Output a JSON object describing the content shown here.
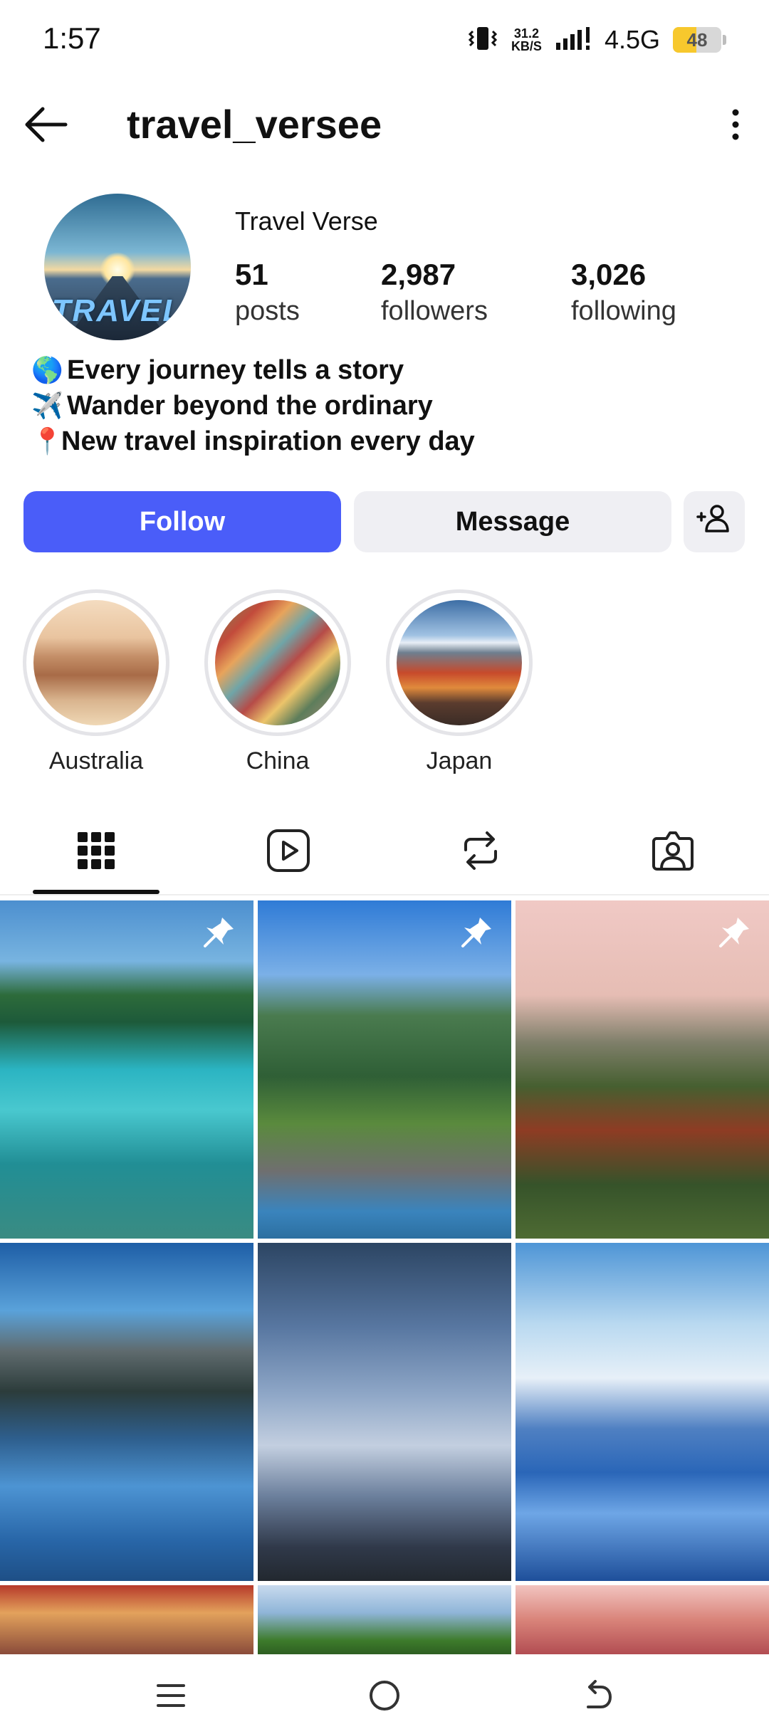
{
  "status_bar": {
    "time": "1:57",
    "net_speed_value": "31.2",
    "net_speed_unit": "KB/S",
    "network_type": "4.5G",
    "battery_level": "48"
  },
  "header": {
    "username": "travel_versee"
  },
  "profile": {
    "display_name": "Travel Verse",
    "avatar_text": "TRAVEL",
    "stats": [
      {
        "value": "51",
        "label": "posts"
      },
      {
        "value": "2,987",
        "label": "followers"
      },
      {
        "value": "3,026",
        "label": "following"
      }
    ],
    "bio": [
      {
        "emoji": "🌎",
        "text": "Every journey tells a story"
      },
      {
        "emoji": "✈️",
        "text": "Wander beyond the ordinary"
      },
      {
        "emoji": "📍",
        "text": "New travel inspiration every day"
      }
    ]
  },
  "actions": {
    "follow_label": "Follow",
    "message_label": "Message"
  },
  "highlights": [
    {
      "label": "Australia"
    },
    {
      "label": "China"
    },
    {
      "label": "Japan"
    }
  ],
  "tabs": [
    {
      "icon": "grid-icon",
      "selected": true
    },
    {
      "icon": "reels-icon",
      "selected": false
    },
    {
      "icon": "reposts-icon",
      "selected": false
    },
    {
      "icon": "tagged-icon",
      "selected": false
    }
  ],
  "posts": [
    {
      "subject": "tropical-lagoon",
      "pinned": true
    },
    {
      "subject": "lakeside-villa",
      "pinned": true
    },
    {
      "subject": "temples-balloon",
      "pinned": true
    },
    {
      "subject": "mountain-fjord",
      "pinned": false
    },
    {
      "subject": "eiffel-tower",
      "pinned": false
    },
    {
      "subject": "tree-flower-field",
      "pinned": false
    },
    {
      "subject": "rainbow-mountains",
      "pinned": false
    },
    {
      "subject": "green-tree",
      "pinned": false
    },
    {
      "subject": "pink-sky",
      "pinned": false
    }
  ],
  "colors": {
    "follow_button": "#4a5df9",
    "secondary_button": "#efeff3",
    "battery": "#f7c82d"
  }
}
